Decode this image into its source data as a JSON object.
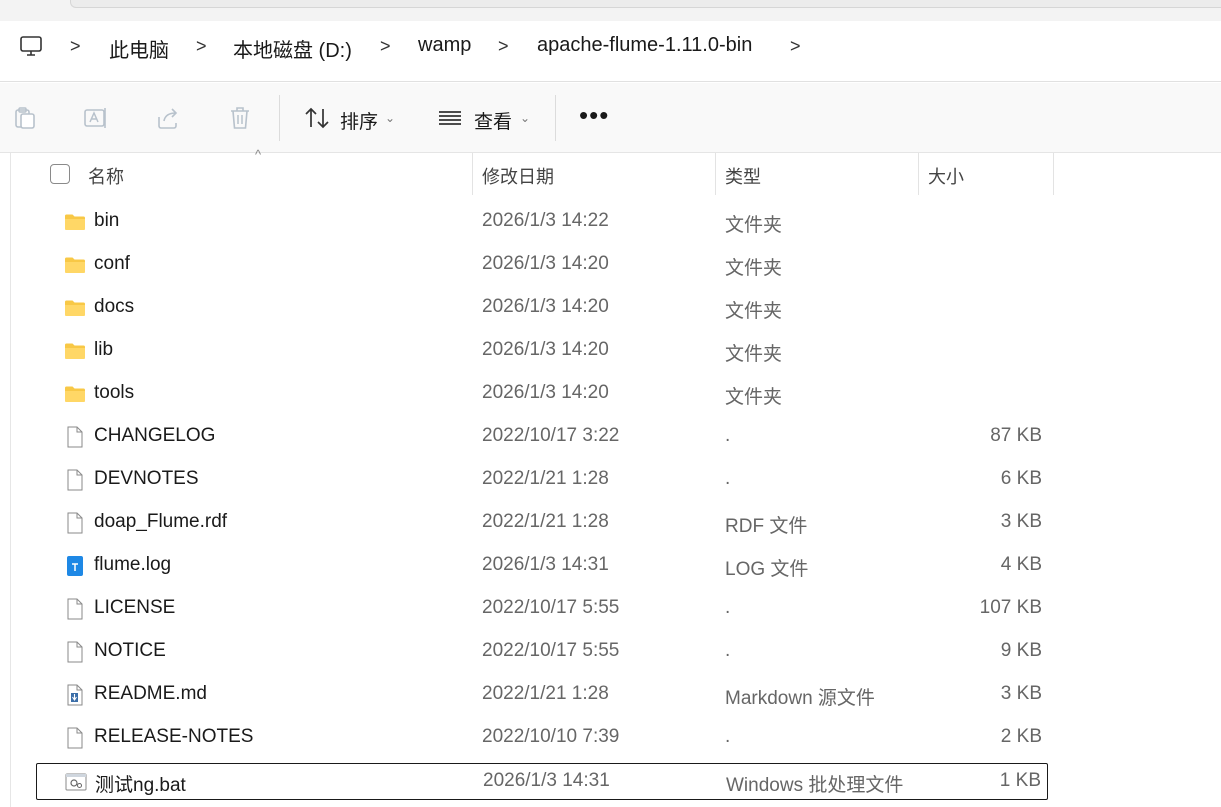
{
  "breadcrumb": {
    "items": [
      "此电脑",
      "本地磁盘 (D:)",
      "wamp",
      "apache-flume-1.11.0-bin"
    ],
    "separator": ">"
  },
  "toolbar": {
    "sort_label": "排序",
    "view_label": "查看",
    "more_label": "•••",
    "caret": "⌄"
  },
  "columns": {
    "name": "名称",
    "modified": "修改日期",
    "type": "类型",
    "size": "大小",
    "sort_indicator": "^"
  },
  "files": [
    {
      "name": "bin",
      "date": "2026/1/3 14:22",
      "type": "文件夹",
      "size": "",
      "icon": "folder-icon"
    },
    {
      "name": "conf",
      "date": "2026/1/3 14:20",
      "type": "文件夹",
      "size": "",
      "icon": "folder-icon"
    },
    {
      "name": "docs",
      "date": "2026/1/3 14:20",
      "type": "文件夹",
      "size": "",
      "icon": "folder-icon"
    },
    {
      "name": "lib",
      "date": "2026/1/3 14:20",
      "type": "文件夹",
      "size": "",
      "icon": "folder-icon"
    },
    {
      "name": "tools",
      "date": "2026/1/3 14:20",
      "type": "文件夹",
      "size": "",
      "icon": "folder-icon"
    },
    {
      "name": "CHANGELOG",
      "date": "2022/10/17 3:22",
      "type": ".",
      "size": "87 KB",
      "icon": "file-icon"
    },
    {
      "name": "DEVNOTES",
      "date": "2022/1/21 1:28",
      "type": ".",
      "size": "6 KB",
      "icon": "file-icon"
    },
    {
      "name": "doap_Flume.rdf",
      "date": "2022/1/21 1:28",
      "type": "RDF 文件",
      "size": "3 KB",
      "icon": "file-icon"
    },
    {
      "name": "flume.log",
      "date": "2026/1/3 14:31",
      "type": "LOG 文件",
      "size": "4 KB",
      "icon": "text-file-icon"
    },
    {
      "name": "LICENSE",
      "date": "2022/10/17 5:55",
      "type": ".",
      "size": "107 KB",
      "icon": "file-icon"
    },
    {
      "name": "NOTICE",
      "date": "2022/10/17 5:55",
      "type": ".",
      "size": "9 KB",
      "icon": "file-icon"
    },
    {
      "name": "README.md",
      "date": "2022/1/21 1:28",
      "type": "Markdown 源文件",
      "size": "3 KB",
      "icon": "markdown-file-icon"
    },
    {
      "name": "RELEASE-NOTES",
      "date": "2022/10/10 7:39",
      "type": ".",
      "size": "2 KB",
      "icon": "file-icon"
    },
    {
      "name": "测试ng.bat",
      "date": "2026/1/3 14:31",
      "type": "Windows 批处理文件",
      "size": "1 KB",
      "icon": "batch-file-icon"
    }
  ],
  "colors": {
    "folder": "#F8C846",
    "log_icon": "#1E88E5",
    "selection_border": "#1A1A1A"
  }
}
